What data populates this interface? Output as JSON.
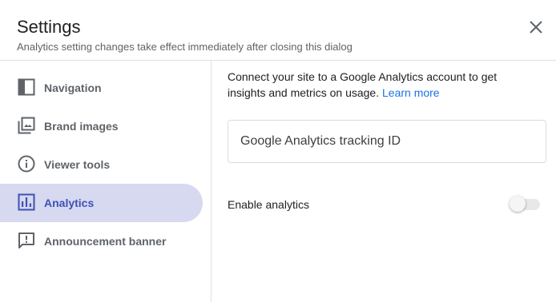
{
  "dialog": {
    "title": "Settings",
    "subtitle": "Analytics setting changes take effect immediately after closing this dialog"
  },
  "sidebar": {
    "items": [
      {
        "label": "Navigation",
        "icon": "navigation-panel-icon",
        "active": false
      },
      {
        "label": "Brand images",
        "icon": "images-icon",
        "active": false
      },
      {
        "label": "Viewer tools",
        "icon": "info-icon",
        "active": false
      },
      {
        "label": "Analytics",
        "icon": "analytics-chart-icon",
        "active": true
      },
      {
        "label": "Announcement banner",
        "icon": "announcement-icon",
        "active": false
      }
    ]
  },
  "main": {
    "description": "Connect your site to a Google Analytics account to get insights and metrics on usage. ",
    "learn_more": "Learn more",
    "tracking_id": {
      "placeholder": "Google Analytics tracking ID",
      "value": ""
    },
    "enable_label": "Enable analytics",
    "enable_value": false
  },
  "colors": {
    "active_bg": "#d6d9ef",
    "active_text": "#3f51b5",
    "link": "#1a73e8"
  }
}
